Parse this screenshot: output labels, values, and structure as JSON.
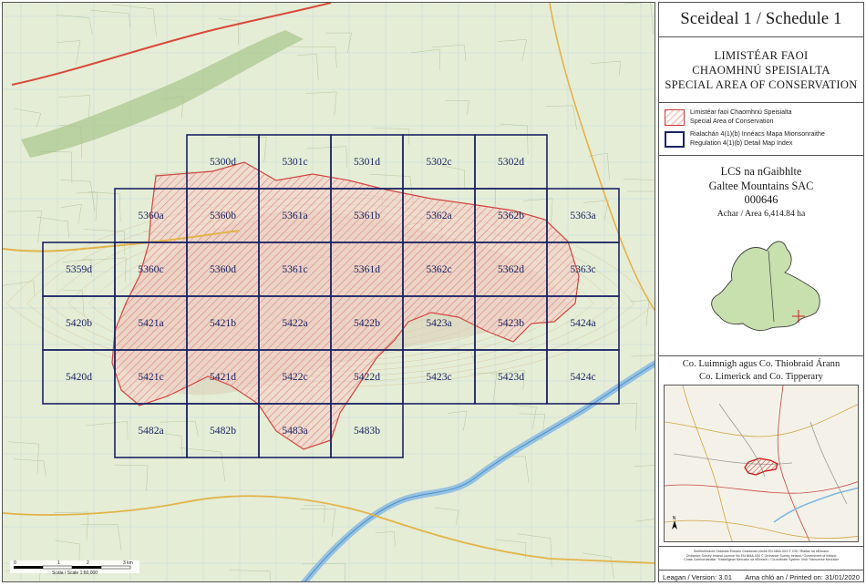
{
  "title": "Sceideal 1 / Schedule 1",
  "designation": {
    "line1": "LIMISTÉAR FAOI",
    "line2": "CHAOMHNÚ SPEISIALTA",
    "line3": "SPECIAL AREA OF CONSERVATION"
  },
  "legend": {
    "sac_line1": "Limistéar faoi Chaomhnú Speisialta",
    "sac_line2": "Special Area of Conservation",
    "index_line1": "Rialachán 4(1)(b) Innéacs Mapa Mionsonraithe",
    "index_line2": "Regulation 4(1)(b) Detail Map Index"
  },
  "site": {
    "name_ga": "LCS na nGaibhlte",
    "name_en": "Galtee Mountains SAC",
    "code": "000646",
    "area": "Achar / Area 6,414.84 ha"
  },
  "counties": {
    "ga": "Co. Luimnigh agus Co. Thiobraid Árann",
    "en": "Co. Limerick and Co. Tipperary"
  },
  "copyright": {
    "line1": "Suirbhéireacht Ordanáis Éireann Ceadúnas Uimhir EN-NMA-004 © OSi / Rialtas na hÉireann",
    "line2": "Ordnance Survey Ireland Licence No EN-NMA-004 © Ordnance Survey Ireland / Government of Ireland",
    "line3": "Córas Comhordanáidí: Trasteilgean Mercator na hÉireann / Co-ordinate System: Irish Transverse Mercator"
  },
  "footer": {
    "version": "Leagan / Version: 3.01",
    "printed": "Arna chló an / Printed on: 31/01/2020"
  },
  "scale": {
    "ticks": [
      "0",
      "1",
      "2",
      "3 km"
    ],
    "label": "Scála / Scale 1:60,000"
  },
  "colors": {
    "grid_line": "#1b2466",
    "sac_hatch": "#cc3b3b",
    "sac_fill": "#f2c4c4",
    "map_background": "#e9efd9",
    "river": "#7fb7e0"
  },
  "grid": {
    "rows": [
      [
        "5300d",
        "5301c",
        "5301d",
        "5302c",
        "5302d"
      ],
      [
        "5360a",
        "5360b",
        "5361a",
        "5361b",
        "5362a",
        "5362b",
        "5363a"
      ],
      [
        "5359d",
        "5360c",
        "5360d",
        "5361c",
        "5361d",
        "5362c",
        "5362d",
        "5363c"
      ],
      [
        "5420b",
        "5421a",
        "5421b",
        "5422a",
        "5422b",
        "5423a",
        "5423b",
        "5424a"
      ],
      [
        "5420d",
        "5421c",
        "5421d",
        "5422c",
        "5422d",
        "5423c",
        "5423d",
        "5424c"
      ],
      [
        "5482a",
        "5482b",
        "5483a",
        "5483b"
      ]
    ]
  },
  "map_features": {
    "north_arrow_letter": "N"
  }
}
